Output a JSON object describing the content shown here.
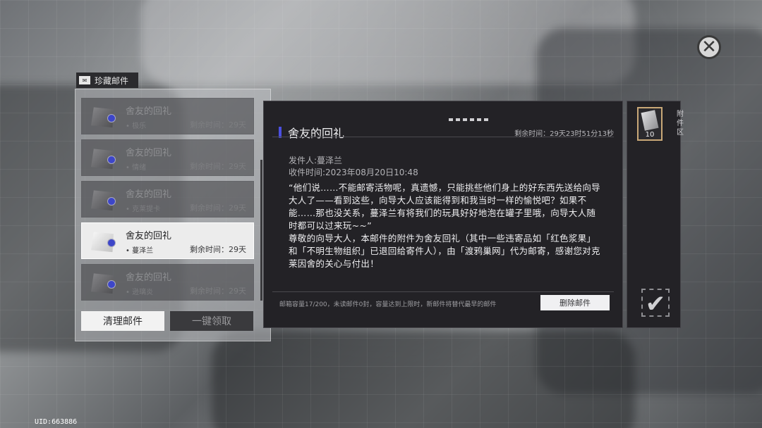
{
  "header": {
    "tab_label": "珍藏邮件",
    "tab_icon": "mail-tab-icon",
    "close_icon": "close-x-icon"
  },
  "mail_list": {
    "items": [
      {
        "title": "舍友的回礼",
        "sender": "• 极乐",
        "remaining": "剩余时间：29天",
        "selected": false
      },
      {
        "title": "舍友的回礼",
        "sender": "• 情绪",
        "remaining": "剩余时间：29天",
        "selected": false
      },
      {
        "title": "舍友的回礼",
        "sender": "• 克莱提卡",
        "remaining": "剩余时间：29天",
        "selected": false
      },
      {
        "title": "舍友的回礼",
        "sender": "• 蔓泽兰",
        "remaining": "剩余时间：29天",
        "selected": true
      },
      {
        "title": "舍友的回礼",
        "sender": "• 逊璃炎",
        "remaining": "剩余时间：29天",
        "selected": false
      }
    ],
    "clean_button": "清理邮件",
    "claim_all_button": "一键领取"
  },
  "mail_detail": {
    "title": "舍友的回礼",
    "countdown": "剩余时间：29天23时51分13秒",
    "sender": "发件人:蔓泽兰",
    "received": "收件时间:2023年08月20日10:48",
    "body_p1": "“他们说……不能邮寄活物呢，真遗憾，只能挑些他们身上的好东西先送给向导大人了——看到这些，向导大人应该能得到和我当时一样的愉悦吧？如果不能……那也没关系，蔓泽兰有将我们的玩具好好地泡在罐子里哦，向导大人随时都可以过来玩~~”",
    "body_p2": "尊敬的向导大人，本邮件的附件为舍友回礼（其中一些违寄品如「红色浆果」和「不明生物组织」已退回给寄件人），由「渡鸦巢网」代为邮寄，感谢您对克莱因舍的关心与付出！",
    "footer_info": "邮箱容量17/200，未读邮件0封，容量达到上限时，新邮件将替代最早的邮件",
    "delete_button": "删除邮件"
  },
  "attachments": {
    "label": "附\n件\n区",
    "items": [
      {
        "icon": "paper-item-icon",
        "count": "10"
      }
    ],
    "confirm_icon": "checkmark-icon"
  },
  "footer": {
    "uid": "UID:663886"
  },
  "colors": {
    "accent": "#4b4fe0",
    "seal": "#3d46c9",
    "attachment_border": "#c9a877"
  }
}
